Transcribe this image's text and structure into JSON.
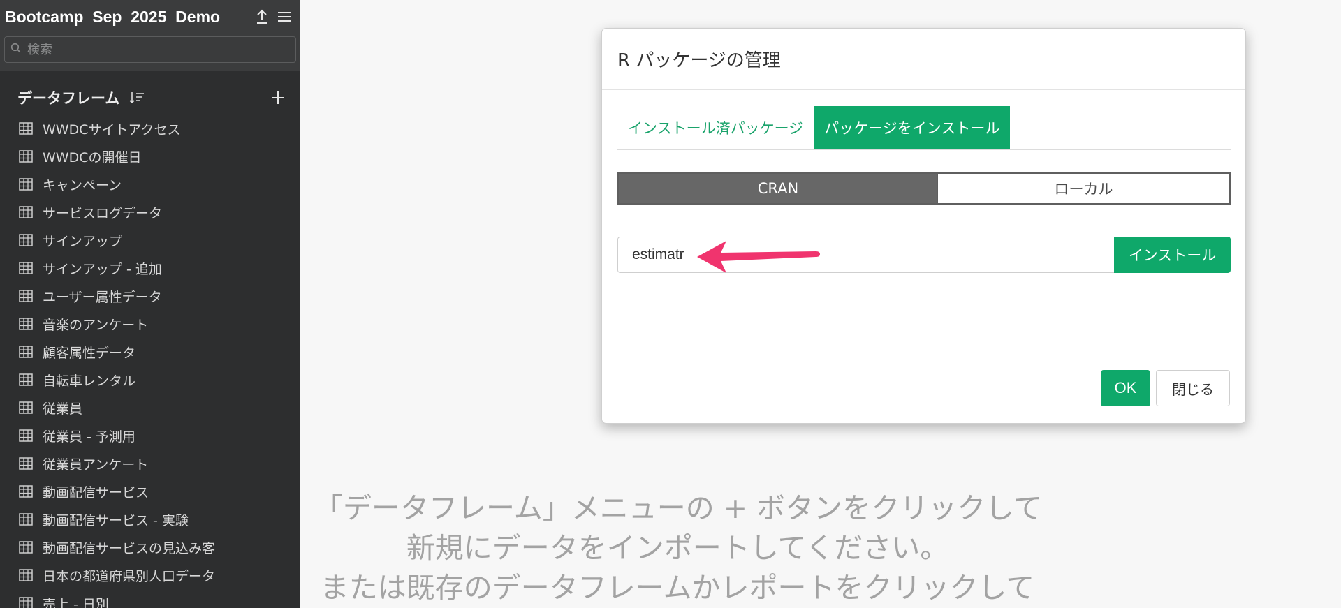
{
  "project": {
    "title": "Bootcamp_Sep_2025_Demo",
    "upload_icon": "upload-icon",
    "menu_icon": "hamburger-menu-icon"
  },
  "search": {
    "placeholder": "検索"
  },
  "dataframes": {
    "section_title": "データフレーム",
    "items": [
      "WWDCサイトアクセス",
      "WWDCの開催日",
      "キャンペーン",
      "サービスログデータ",
      "サインアップ",
      "サインアップ - 追加",
      "ユーザー属性データ",
      "音楽のアンケート",
      "顧客属性データ",
      "自転車レンタル",
      "従業員",
      "従業員 - 予測用",
      "従業員アンケート",
      "動画配信サービス",
      "動画配信サービス - 実験",
      "動画配信サービスの見込み客",
      "日本の都道府県別人口データ",
      "売上 - 日別"
    ]
  },
  "dialog": {
    "title": "R パッケージの管理",
    "tabs": {
      "installed": "インストール済パッケージ",
      "install": "パッケージをインストール"
    },
    "source": {
      "cran": "CRAN",
      "local": "ローカル"
    },
    "package_input_value": "estimatr",
    "install_button": "インストール",
    "ok_button": "OK",
    "close_button": "閉じる"
  },
  "empty_message": {
    "line1": "「データフレーム」メニューの + ボタンをクリックして",
    "line2": "新規にデータをインポートしてください。",
    "line3": "または既存のデータフレームかレポートをクリックして"
  },
  "colors": {
    "accent": "#0fa86a",
    "arrow": "#f0346e",
    "sidebar": "#2d2e2f"
  }
}
